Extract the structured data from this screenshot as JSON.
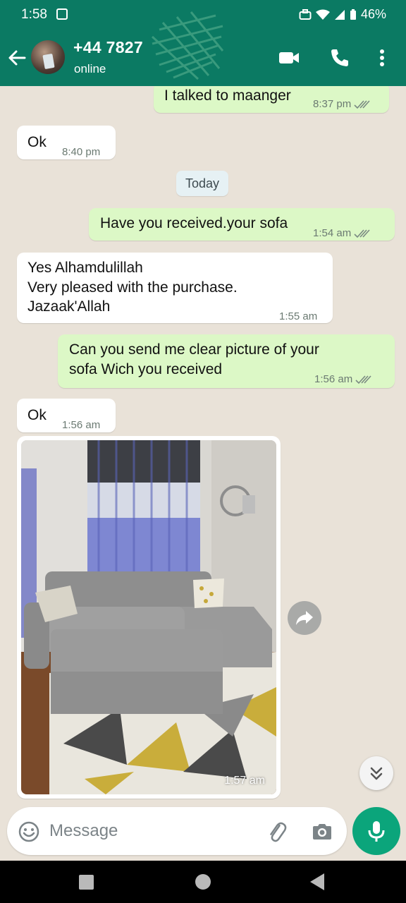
{
  "status_bar": {
    "time": "1:58",
    "battery": "46%"
  },
  "header": {
    "contact": "+44 7827",
    "status": "online"
  },
  "messages": [
    {
      "dir": "out",
      "text": "I talked to maanger",
      "time": "8:37 pm"
    },
    {
      "dir": "in",
      "text": "Ok",
      "time": "8:40 pm"
    },
    {
      "dir": "out",
      "text": "Have you received.your sofa",
      "time": "1:54 am"
    },
    {
      "dir": "in",
      "lines": [
        "Yes Alhamdulillah",
        "Very pleased with the purchase.",
        "Jazaak'Allah"
      ],
      "time": "1:55 am"
    },
    {
      "dir": "out",
      "lines": [
        "Can you send me clear picture of your",
        "sofa Wich you received"
      ],
      "time": "1:56 am"
    },
    {
      "dir": "in",
      "text": "Ok",
      "time": "1:56 am"
    }
  ],
  "date_separator": "Today",
  "image_message": {
    "time": "1:57 am"
  },
  "composer": {
    "placeholder": "Message"
  },
  "colors": {
    "header": "#0b7a63",
    "outgoing": "#dcf8c6",
    "incoming": "#ffffff",
    "accent": "#0ba57b",
    "chat_bg": "#e9e2d8"
  },
  "icons": [
    "back-arrow-icon",
    "video-call-icon",
    "phone-icon",
    "more-vert-icon",
    "double-tick-icon",
    "forward-icon",
    "chevron-double-down-icon",
    "emoji-icon",
    "attach-icon",
    "camera-icon",
    "mic-icon"
  ]
}
